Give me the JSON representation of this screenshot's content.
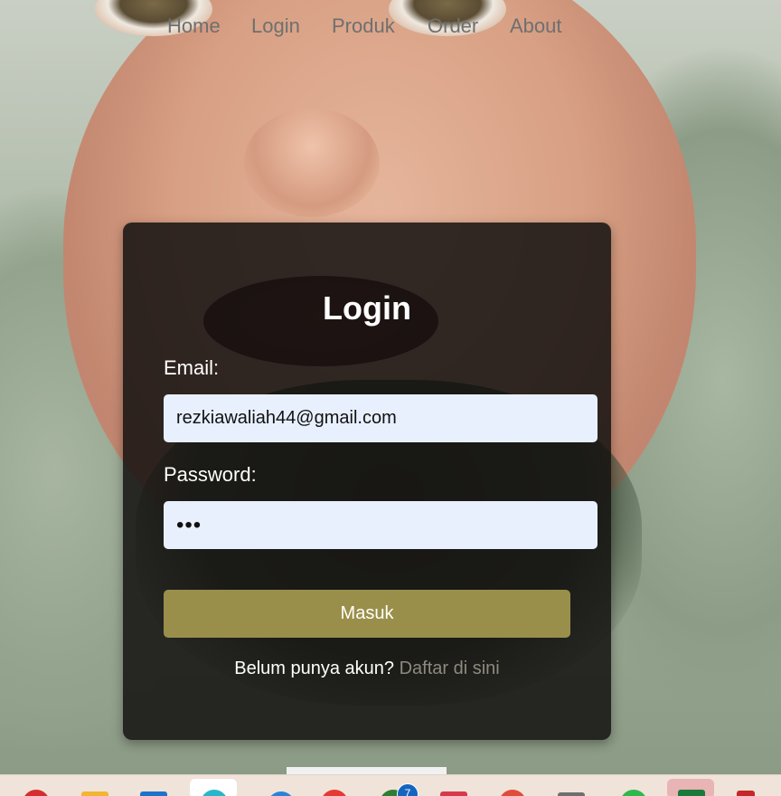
{
  "nav": {
    "items": [
      "Home",
      "Login",
      "Produk",
      "Order",
      "About"
    ]
  },
  "login": {
    "title": "Login",
    "email_label": "Email:",
    "email_value": "rezkiawaliah44@gmail.com",
    "password_label": "Password:",
    "password_value": "•••",
    "submit_label": "Masuk",
    "register_prompt": "Belum punya akun?",
    "register_link": "Daftar di sini"
  },
  "taskbar": {
    "badge_count": "7"
  },
  "colors": {
    "button": "#9a8f4a",
    "input_bg": "#e8f0fe",
    "card_bg": "rgba(20,18,16,0.86)",
    "link": "#8d8a7e"
  }
}
